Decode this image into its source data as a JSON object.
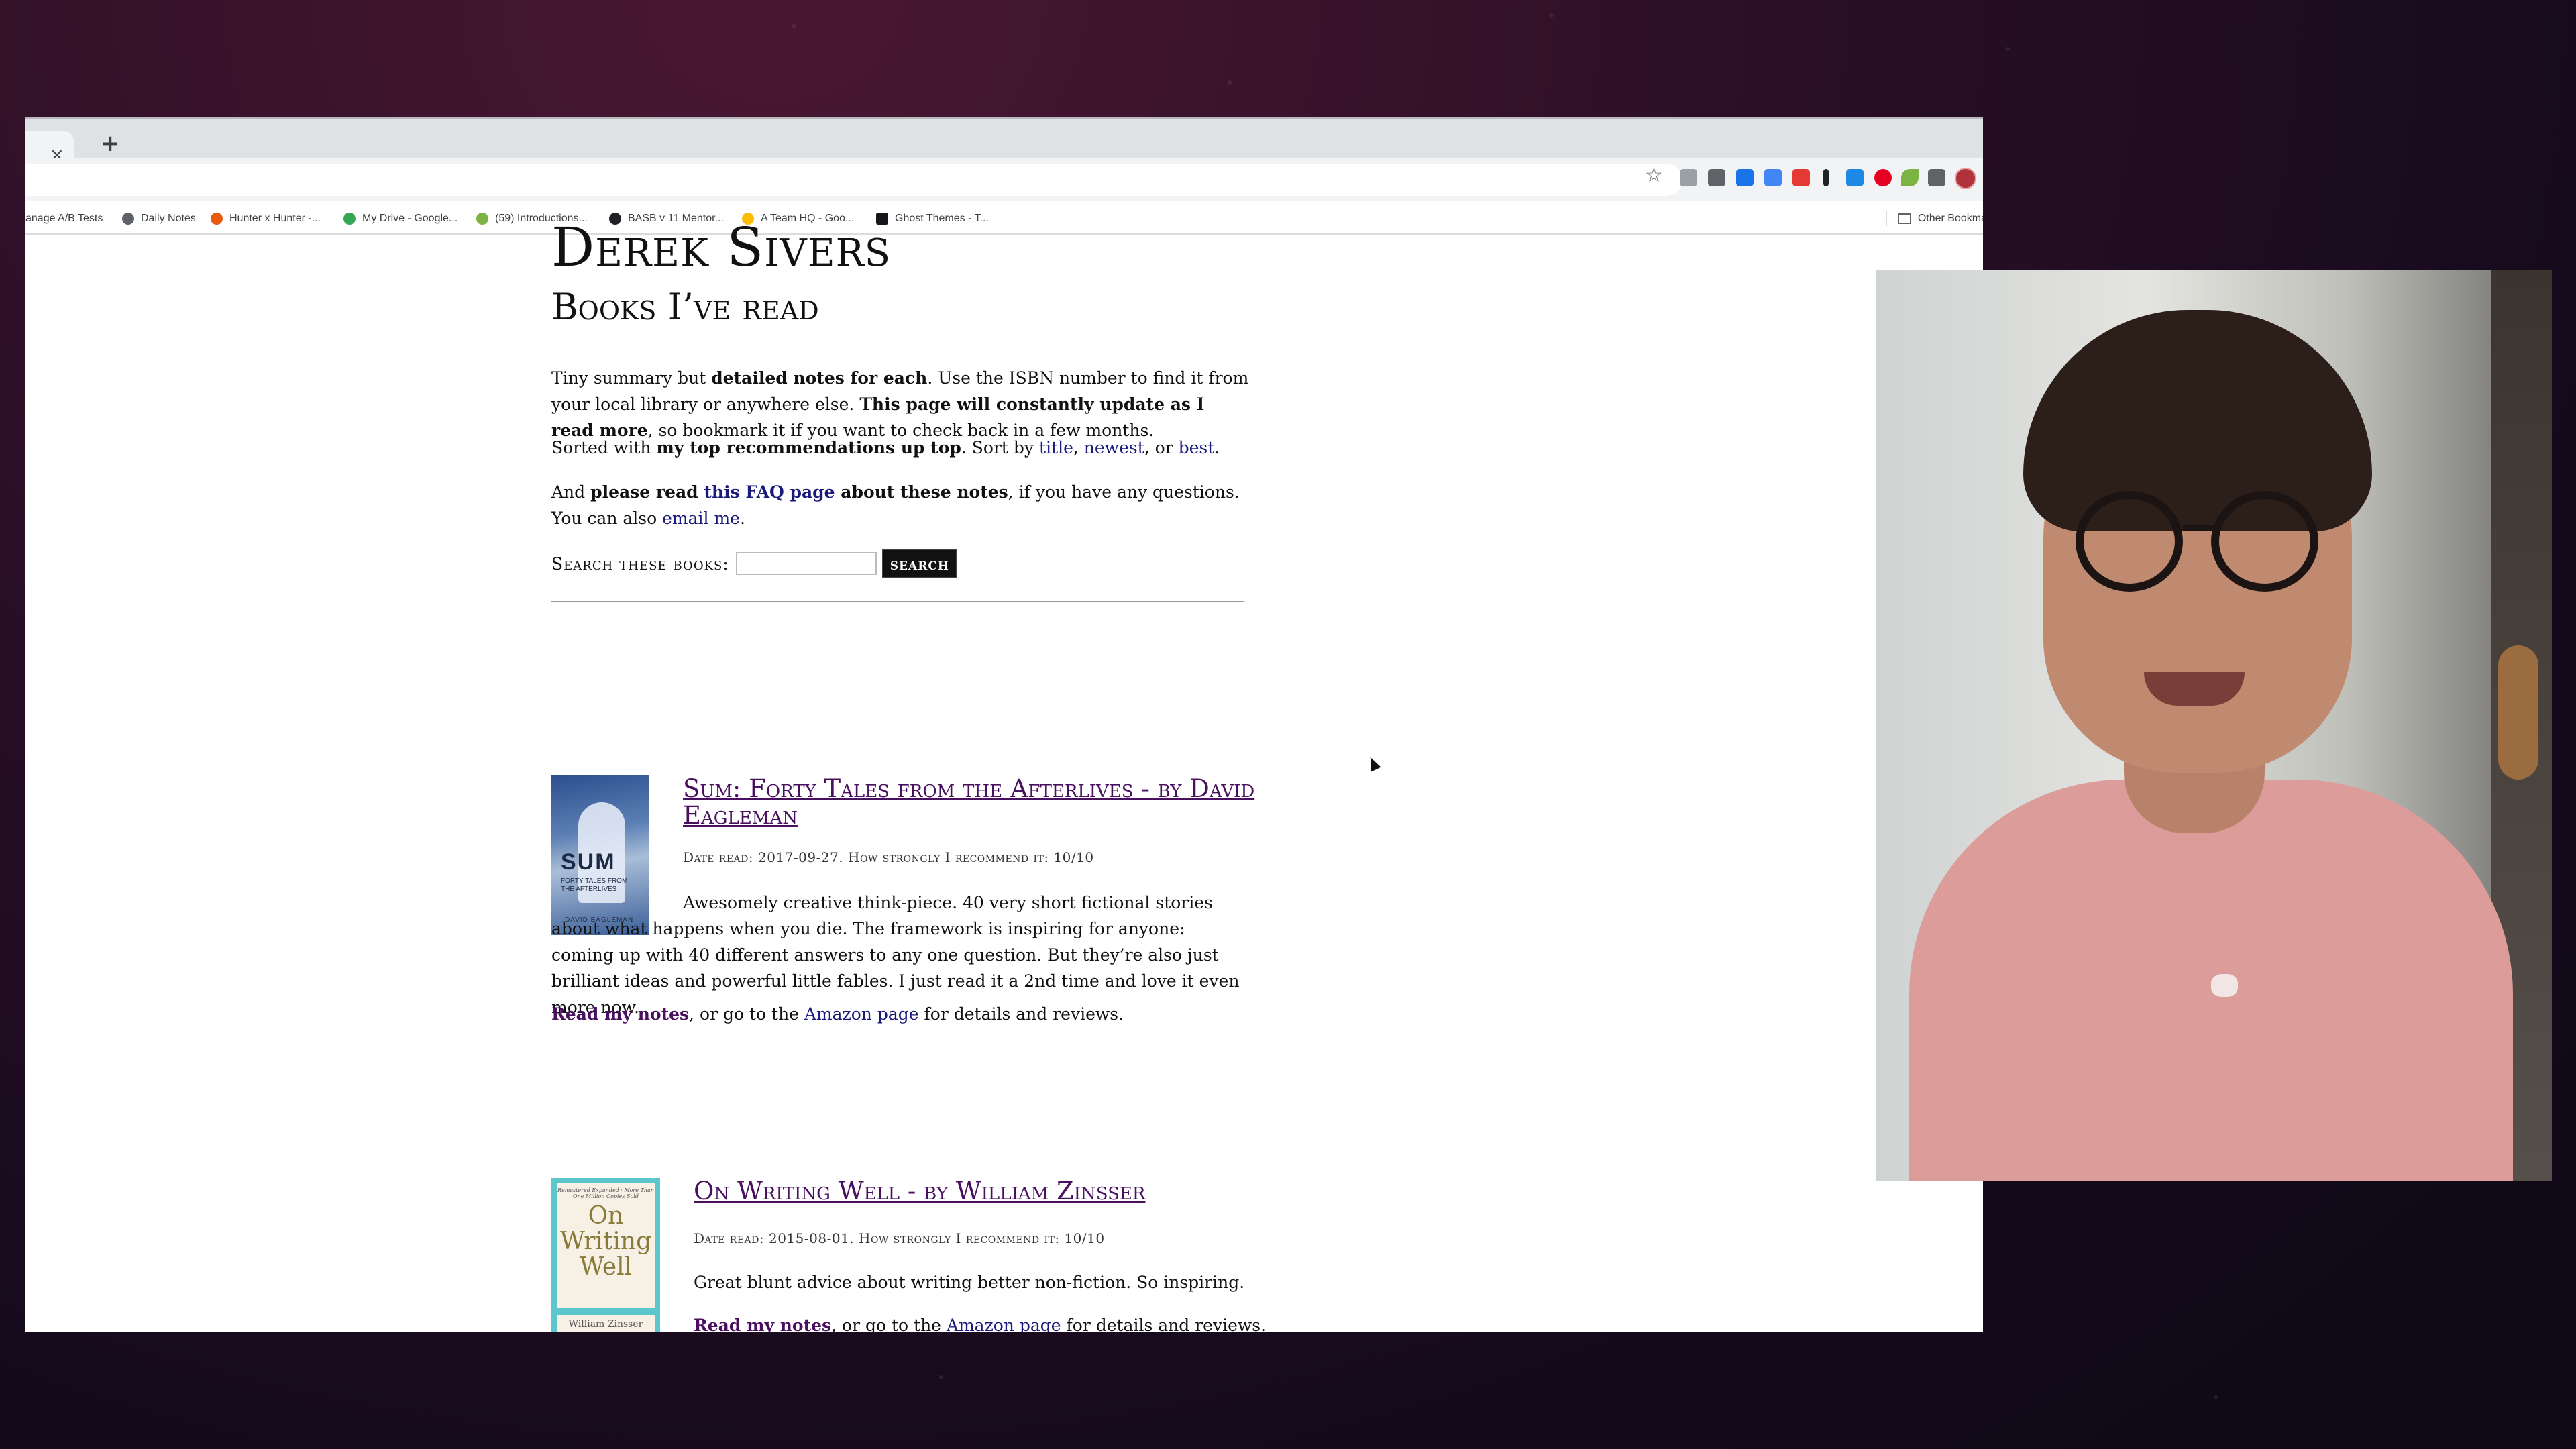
{
  "browser": {
    "tab_close_glyph": "×",
    "new_tab_glyph": "+",
    "star_glyph": "☆",
    "bookmarks": [
      {
        "label": "anage A/B Tests",
        "icon": "page-icon",
        "color": "#ffffff"
      },
      {
        "label": "Daily Notes",
        "icon": "globe-icon",
        "color": "#5f6368"
      },
      {
        "label": "Hunter x Hunter -...",
        "icon": "fire-icon",
        "color": "#e8590c"
      },
      {
        "label": "My Drive - Google...",
        "icon": "google-drive-icon",
        "color": "#34a853"
      },
      {
        "label": "(59) Introductions...",
        "icon": "circle-icon",
        "color": "#7cb342"
      },
      {
        "label": "BASB v 11 Mentor...",
        "icon": "chat-icon",
        "color": "#202124"
      },
      {
        "label": "A Team HQ - Goo...",
        "icon": "google-drive-icon",
        "color": "#fbbc04"
      },
      {
        "label": "Ghost Themes - T...",
        "icon": "ghost-icon",
        "color": "#15171a"
      }
    ],
    "other_bookmarks": "Other Bookma",
    "extensions": [
      {
        "icon": "extension-gray-icon",
        "color": "#9aa0a6"
      },
      {
        "icon": "extension-dark-icon",
        "color": "#5f6368"
      },
      {
        "icon": "extension-blue-icon",
        "color": "#1a73e8"
      },
      {
        "icon": "extension-iq-icon",
        "color": "#4285f4"
      },
      {
        "icon": "extension-red-icon",
        "color": "#e53935"
      },
      {
        "icon": "extension-bar-icon",
        "color": "#202124"
      },
      {
        "icon": "extension-cyan-icon",
        "color": "#1e88e5"
      },
      {
        "icon": "pinterest-icon",
        "color": "#e60023"
      },
      {
        "icon": "leaf-icon",
        "color": "#7cb342"
      },
      {
        "icon": "puzzle-icon",
        "color": "#5f6368"
      }
    ]
  },
  "page": {
    "site_title": "Derek Sivers",
    "section_title": "Books I’ve read",
    "intro1": {
      "t1": "Tiny summary but ",
      "b1": "detailed notes for each",
      "t2": ". Use the ISBN number to find it from your local library or anywhere else. ",
      "b2": "This page will constantly update as I read more",
      "t3": ", so bookmark it if you want to check back in a few months."
    },
    "intro2": {
      "t1": "Sorted with ",
      "b1": "my top recommendations up top",
      "t2": ". Sort by ",
      "l1": "title",
      "t3": ", ",
      "l2": "newest",
      "t4": ", or ",
      "l3": "best",
      "t5": "."
    },
    "intro3": {
      "t1": "And ",
      "b1": "please read ",
      "l1": "this FAQ page",
      "b2": " about these notes",
      "t2": ", if you have any questions. You can also ",
      "l2": "email me",
      "t3": "."
    },
    "search": {
      "label": "Search these books:",
      "value": "",
      "button": "search"
    },
    "books": [
      {
        "cover_title": "SUM",
        "cover_subtitle": "FORTY TALES FROM THE AFTERLIVES",
        "cover_author": "DAVID EAGLEMAN",
        "title": "Sum: Forty Tales from the Afterlives - by David Eagleman",
        "meta": "Date read: 2017-09-27. How strongly I recommend it: 10/10",
        "description": "Awesomely creative think-piece. 40 very short fictional stories about what happens when you die. The framework is inspiring for anyone: coming up with 40 different answers to any one question. But they’re also just brilliant ideas and powerful little fables. I just read it a 2nd time and love it even more now.",
        "notes_link": "Read my notes",
        "notes_mid": ", or go to the ",
        "amazon_link": "Amazon page",
        "notes_end": " for details and reviews."
      },
      {
        "cover_top": "Remastered Expanded · More Than One Million Copies Sold",
        "cover_title": "On Writing Well",
        "cover_author": "William Zinsser",
        "title": "On Writing Well - by William Zinsser",
        "meta": "Date read: 2015-08-01. How strongly I recommend it: 10/10",
        "description": "Great blunt advice about writing better non-fiction. So inspiring.",
        "notes_link": "Read my notes",
        "notes_mid": ", or go to the ",
        "amazon_link": "Amazon page",
        "notes_end": " for details and reviews."
      }
    ]
  }
}
